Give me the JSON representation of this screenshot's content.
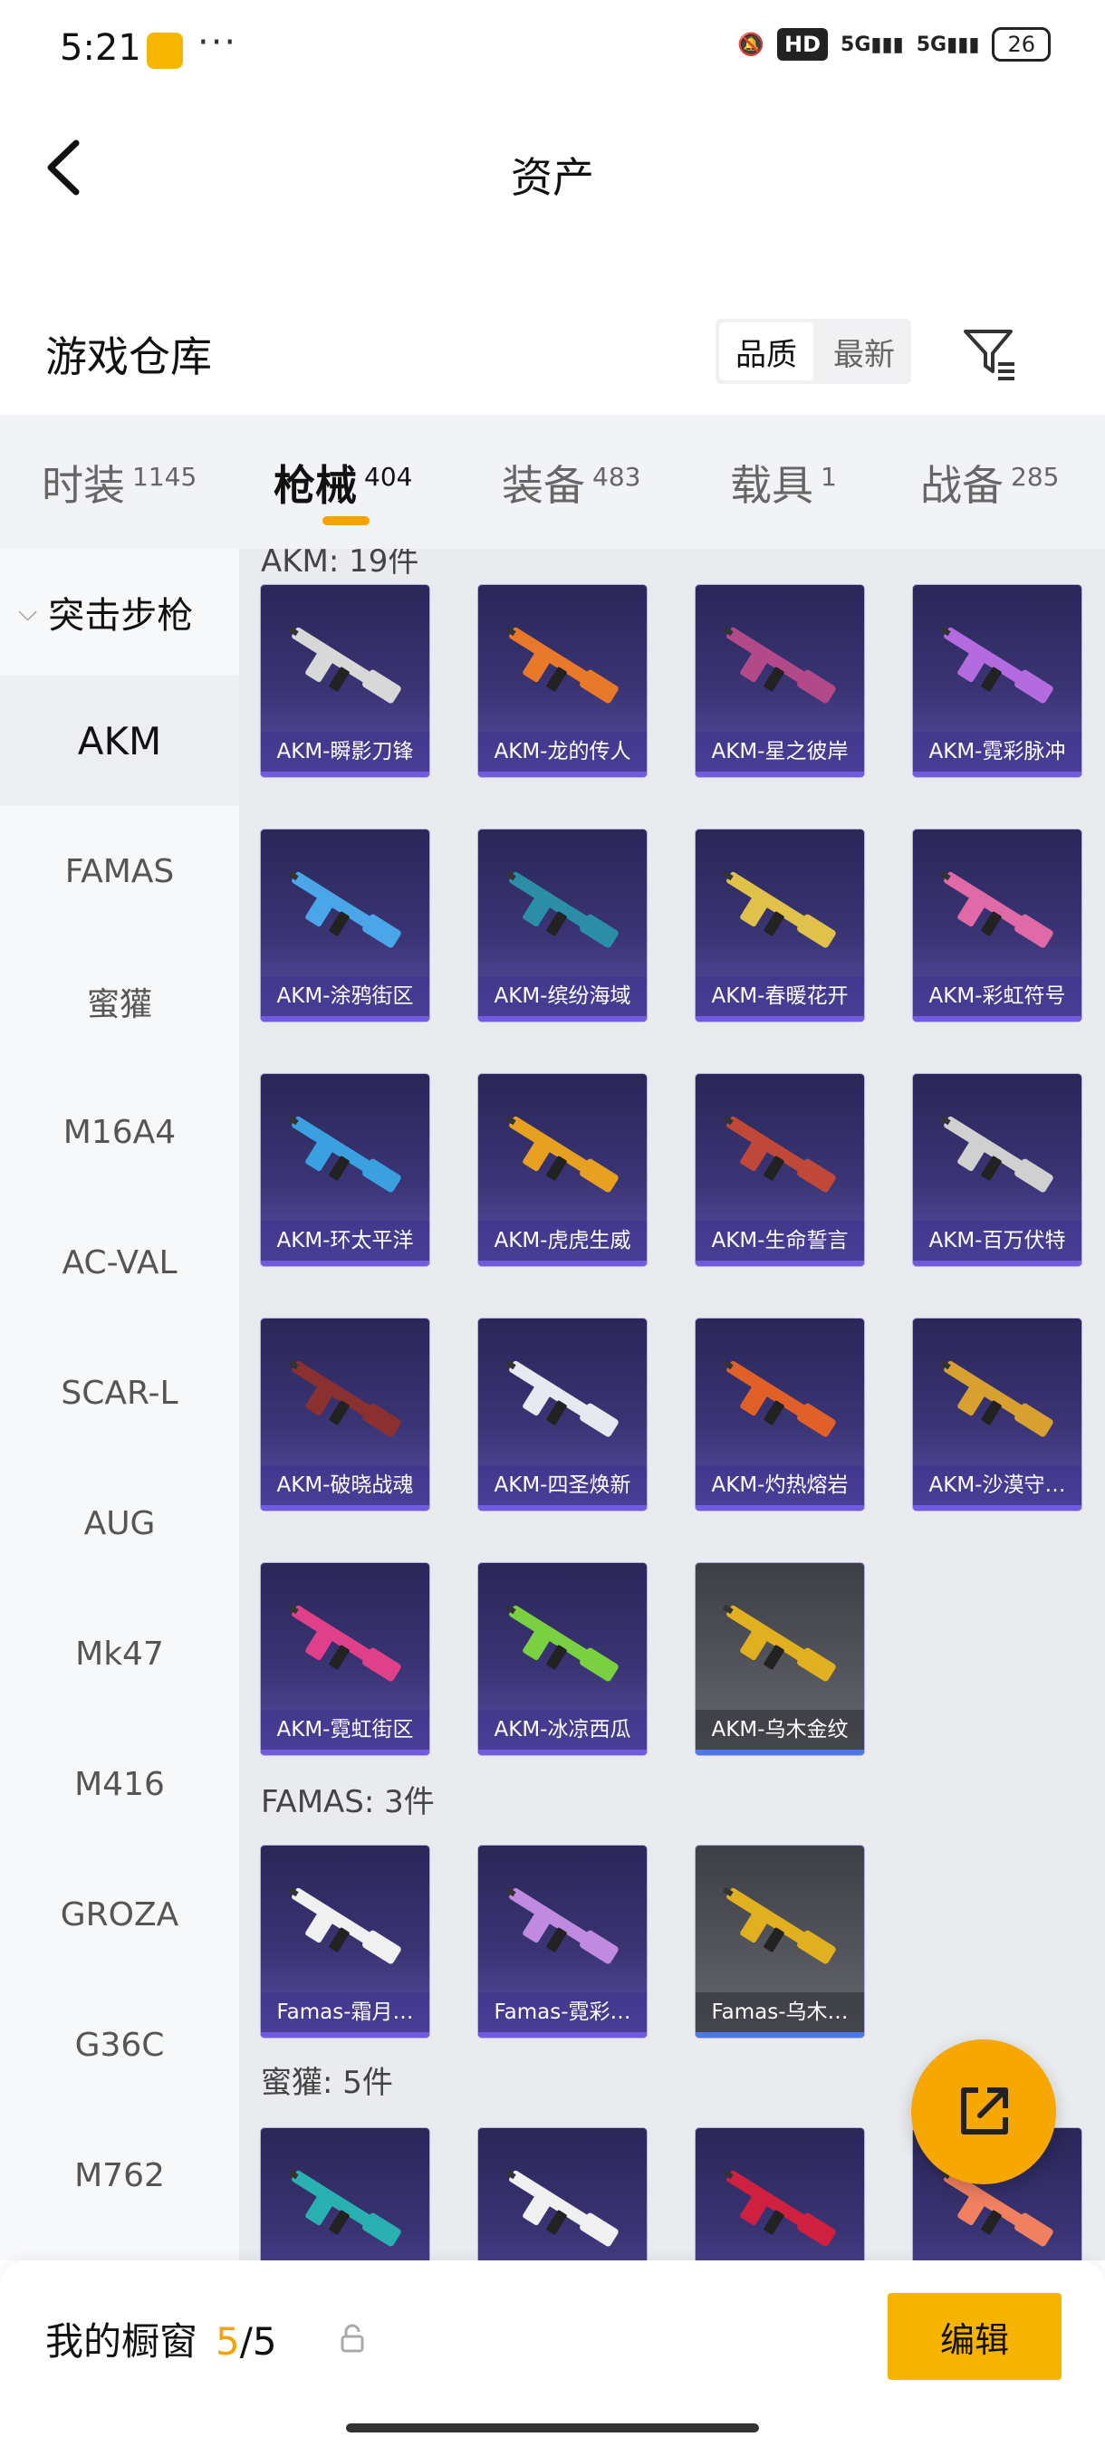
{
  "status": {
    "time": "5:21",
    "hd": "HD",
    "signal1": "5G",
    "signal2": "5G",
    "battery": "26"
  },
  "header": {
    "title": "资产"
  },
  "warehouse": {
    "title": "游戏仓库",
    "sort_quality": "品质",
    "sort_newest": "最新"
  },
  "categories": [
    {
      "label": "时装",
      "count": "1145"
    },
    {
      "label": "枪械",
      "count": "404"
    },
    {
      "label": "装备",
      "count": "483"
    },
    {
      "label": "载具",
      "count": "1"
    },
    {
      "label": "战备",
      "count": "285"
    }
  ],
  "sidebar": {
    "group": "突击步枪",
    "items": [
      "AKM",
      "FAMAS",
      "蜜獾",
      "M16A4",
      "AC-VAL",
      "SCAR-L",
      "AUG",
      "Mk47",
      "M416",
      "GROZA",
      "G36C",
      "M762"
    ]
  },
  "sections": {
    "akm_title": "AKM: 19件",
    "famas_title": "FAMAS: 3件",
    "honey_title": "蜜獾: 5件"
  },
  "akm_items": [
    "AKM-瞬影刀锋",
    "AKM-龙的传人",
    "AKM-星之彼岸",
    "AKM-霓彩脉冲",
    "AKM-涂鸦街区",
    "AKM-缤纷海域",
    "AKM-春暖花开",
    "AKM-彩虹符号",
    "AKM-环太平洋",
    "AKM-虎虎生威",
    "AKM-生命誓言",
    "AKM-百万伏特",
    "AKM-破晓战魂",
    "AKM-四圣焕新",
    "AKM-灼热熔岩",
    "AKM-沙漠守…",
    "AKM-霓虹街区",
    "AKM-冰凉西瓜",
    "AKM-乌木金纹"
  ],
  "famas_items": [
    "Famas-霜月…",
    "Famas-霓彩…",
    "Famas-乌木…"
  ],
  "bottom": {
    "showcase_label": "我的橱窗",
    "current": "5",
    "total": "/5",
    "edit_label": "编辑"
  },
  "colors": {
    "accent": "#f5a300",
    "card_purple": "#3a3475",
    "card_gray": "#55565e"
  }
}
